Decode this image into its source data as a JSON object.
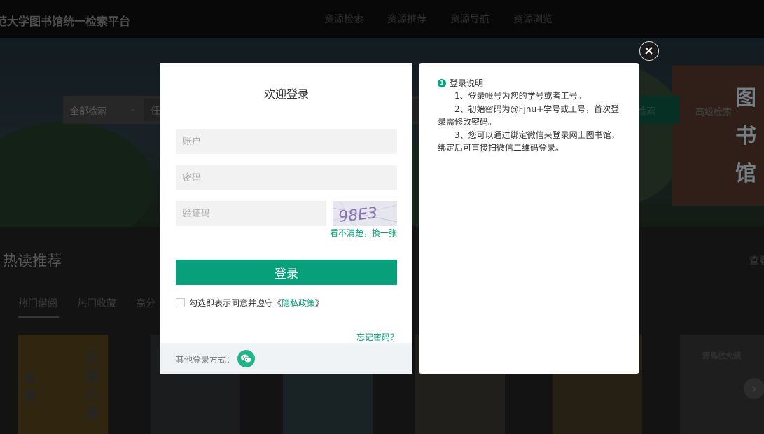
{
  "site": {
    "title": "范大学图书馆统一检索平台",
    "nav": [
      "资源检索",
      "资源推荐",
      "资源导航",
      "资源浏览"
    ]
  },
  "search": {
    "scope": "全部检索",
    "input_partial": "任",
    "button": "检索",
    "advanced": "高级检索",
    "sign_text": "图书馆"
  },
  "hot": {
    "title": "热读推荐",
    "more": "查看",
    "tabs": [
      "热门借阅",
      "热门收藏",
      "高分"
    ],
    "books": [
      "天龍八部",
      "金庸",
      "野鳥放大鏡"
    ]
  },
  "login": {
    "title": "欢迎登录",
    "account_placeholder": "账户",
    "password_placeholder": "密码",
    "captcha_placeholder": "验证码",
    "captcha_text": "98E3",
    "captcha_refresh": "看不清楚，换一张",
    "submit": "登录",
    "agree_prefix": "勾选即表示同意并遵守《",
    "privacy": "隐私政策",
    "agree_suffix": "》",
    "forgot": "忘记密码？",
    "other_label": "其他登录方式："
  },
  "info": {
    "badge": "1",
    "title": "登录说明",
    "lines": [
      "　　1、登录帐号为您的学号或者工号。",
      "　　2、初始密码为@Fjnu+学号或工号，首次登录需修改密码。",
      "　　3、您可以通过绑定微信来登录网上图书馆，绑定后可直接扫微信二维码登录。"
    ]
  },
  "colors": {
    "accent": "#07a07a",
    "overlay": "rgba(0,0,0,0.35)"
  },
  "icons": {
    "close": "close-icon",
    "wechat": "wechat-icon",
    "info": "info-number-icon"
  }
}
